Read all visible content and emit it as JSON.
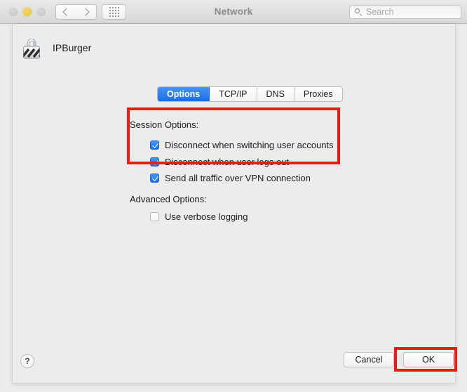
{
  "window": {
    "title": "Network",
    "traffic_lights": [
      {
        "name": "close",
        "state": "inactive",
        "color": "#c2c2c2"
      },
      {
        "name": "minimize",
        "state": "active",
        "color": "#e8c13c"
      },
      {
        "name": "maximize",
        "state": "inactive",
        "color": "#c2c2c2"
      }
    ]
  },
  "toolbar": {
    "back_icon": "chevron-left-icon",
    "forward_icon": "chevron-right-icon",
    "grid_icon": "grid-dots-icon",
    "search": {
      "icon": "search-icon",
      "placeholder": "Search",
      "value": ""
    }
  },
  "sheet": {
    "service": {
      "icon": "vpn-lock-icon",
      "name": "IPBurger"
    },
    "tabs": [
      {
        "label": "Options",
        "selected": true
      },
      {
        "label": "TCP/IP",
        "selected": false
      },
      {
        "label": "DNS",
        "selected": false
      },
      {
        "label": "Proxies",
        "selected": false
      }
    ],
    "groups": [
      {
        "label": "Session Options:",
        "options": [
          {
            "label": "Disconnect when switching user accounts",
            "checked": true
          },
          {
            "label": "Disconnect when user logs out",
            "checked": true
          },
          {
            "label": "Send all traffic over VPN connection",
            "checked": true
          }
        ]
      },
      {
        "label": "Advanced Options:",
        "options": [
          {
            "label": "Use verbose logging",
            "checked": false
          }
        ]
      }
    ],
    "footer": {
      "help_label": "?",
      "cancel_label": "Cancel",
      "ok_label": "OK"
    }
  },
  "annotations": {
    "color": "#e81b17",
    "boxes": [
      {
        "target": "session-options-checkbox-group"
      },
      {
        "target": "ok-button"
      }
    ]
  },
  "theme": {
    "accent": "#1d70e8",
    "tab_selected_bg": "#1a6ee8",
    "window_bg": "#ececec",
    "title_color": "#8a8a8a"
  }
}
